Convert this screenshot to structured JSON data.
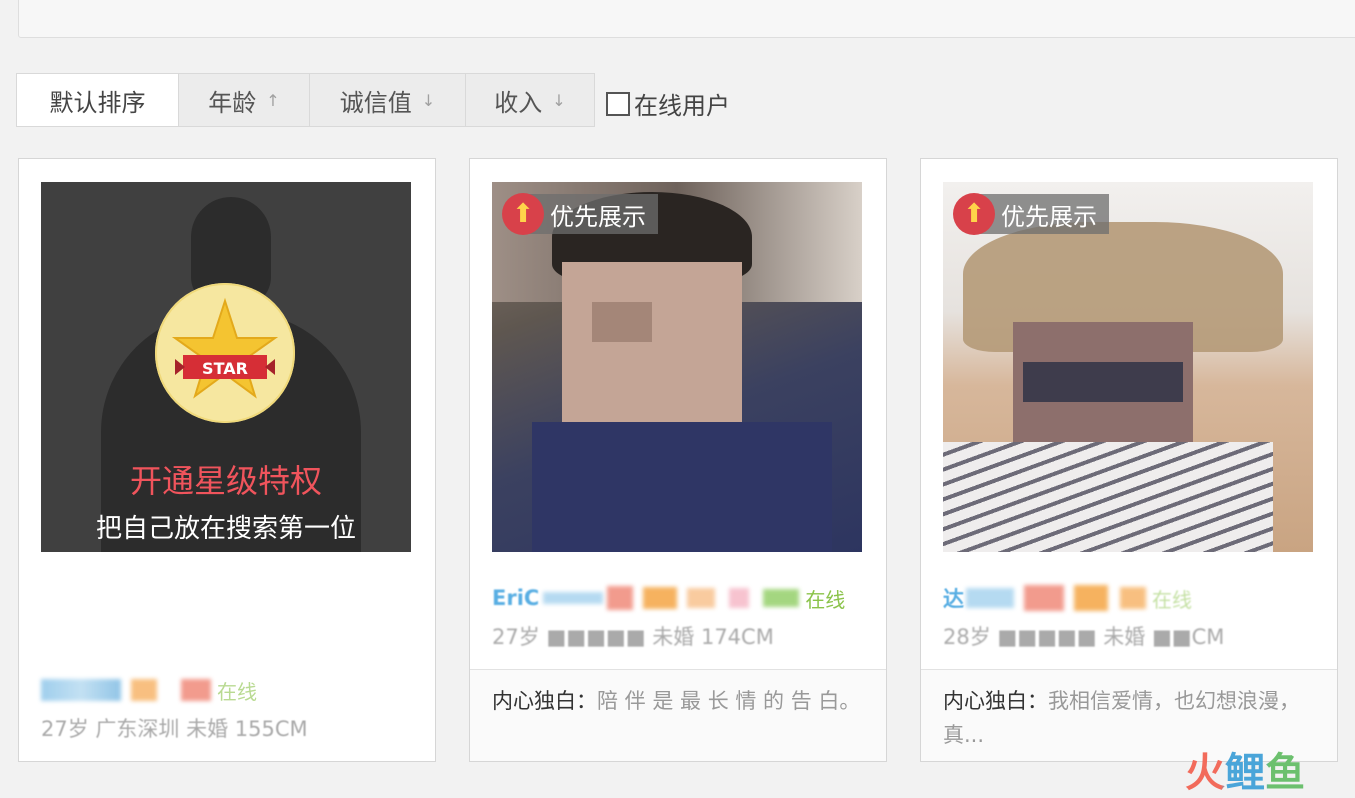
{
  "sort_bar": {
    "default_label": "默认排序",
    "age_label": "年龄",
    "age_arrow": "↑",
    "credit_label": "诚信值",
    "credit_arrow": "↓",
    "income_label": "收入",
    "income_arrow": "↓",
    "online_filter_label": "在线用户"
  },
  "promo_card": {
    "title": "开通星级特权",
    "subtitle": "把自己放在搜索第一位",
    "star_text": "STAR",
    "online": "在线",
    "details": "27岁 广东深圳 未婚 155CM"
  },
  "cards": [
    {
      "badge": "优先展示",
      "name": "EriC",
      "online": "在线",
      "details": "27岁 ■■■■■ 未婚 174CM",
      "monologue_label": "内心独白：",
      "monologue": "陪 伴 是 最 长 情 的 告 白。"
    },
    {
      "badge": "优先展示",
      "name": "达",
      "online": "在线",
      "details": "28岁 ■■■■■ 未婚 ■■CM",
      "monologue_label": "内心独白：",
      "monologue": "我相信爱情，也幻想浪漫，真..."
    }
  ],
  "watermark": "火鲤鱼",
  "colors": {
    "accent_red": "#f0545c",
    "online_green": "#8bc34a",
    "badge_red": "#d8414a"
  }
}
